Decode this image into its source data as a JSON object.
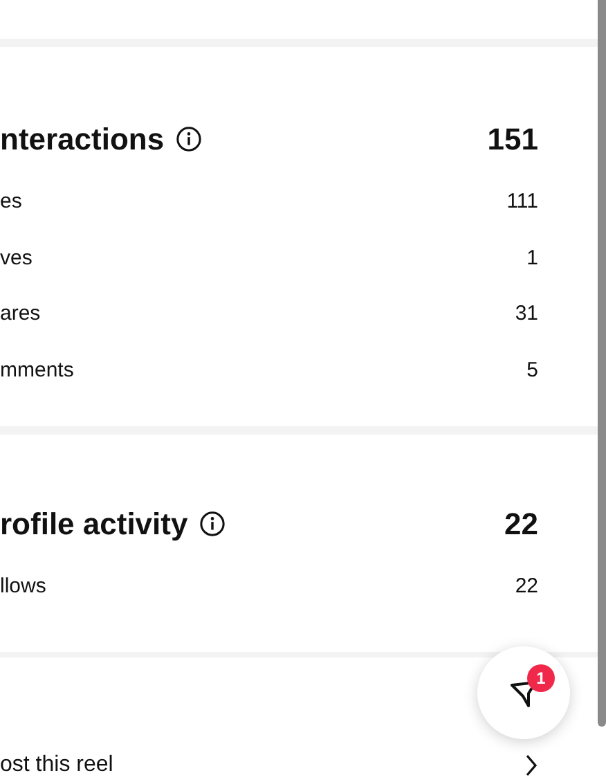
{
  "sections": [
    {
      "title": "nteractions",
      "total": "151",
      "rows": [
        {
          "label": "es",
          "value": "111"
        },
        {
          "label": "ves",
          "value": "1"
        },
        {
          "label": "ares",
          "value": "31"
        },
        {
          "label": "mments",
          "value": "5"
        }
      ]
    },
    {
      "title": "rofile activity",
      "total": "22",
      "rows": [
        {
          "label": "llows",
          "value": "22"
        }
      ]
    }
  ],
  "link_row": {
    "label": "ost this reel"
  },
  "filter_button": {
    "badge": "1"
  }
}
